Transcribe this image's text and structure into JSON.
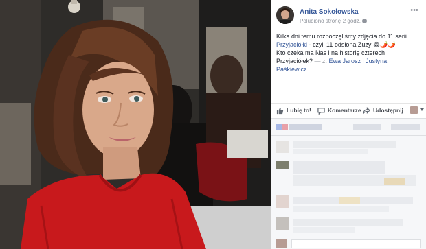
{
  "post": {
    "author": "Anita Sokołowska",
    "meta_liked": "Polubiono stronę",
    "meta_sep": " · ",
    "meta_time": "2 godz.",
    "more": "•••",
    "text": {
      "line1": "Kilka dni temu rozpoczęliśmy zdjęcia do 11 serii",
      "show_link": "Przyjaciółki",
      "line2_rest": " - czyli 11 odsłona Zuzy ",
      "emoji": "😂🌶️🌶️",
      "line3": "Kto czeka ma Nas i na historię czterech Przyjaciółek?",
      "with_prefix": " — z: ",
      "tag1": "Ewa Jarosz",
      "tag_sep": " i ",
      "tag2": "Justyna Paśkiewicz"
    }
  },
  "actions": {
    "like": "Lubię to!",
    "comment": "Komentarze",
    "share": "Udostępnij"
  },
  "colors": {
    "link": "#365899",
    "muted": "#90949c",
    "sweater": "#c8191c"
  }
}
